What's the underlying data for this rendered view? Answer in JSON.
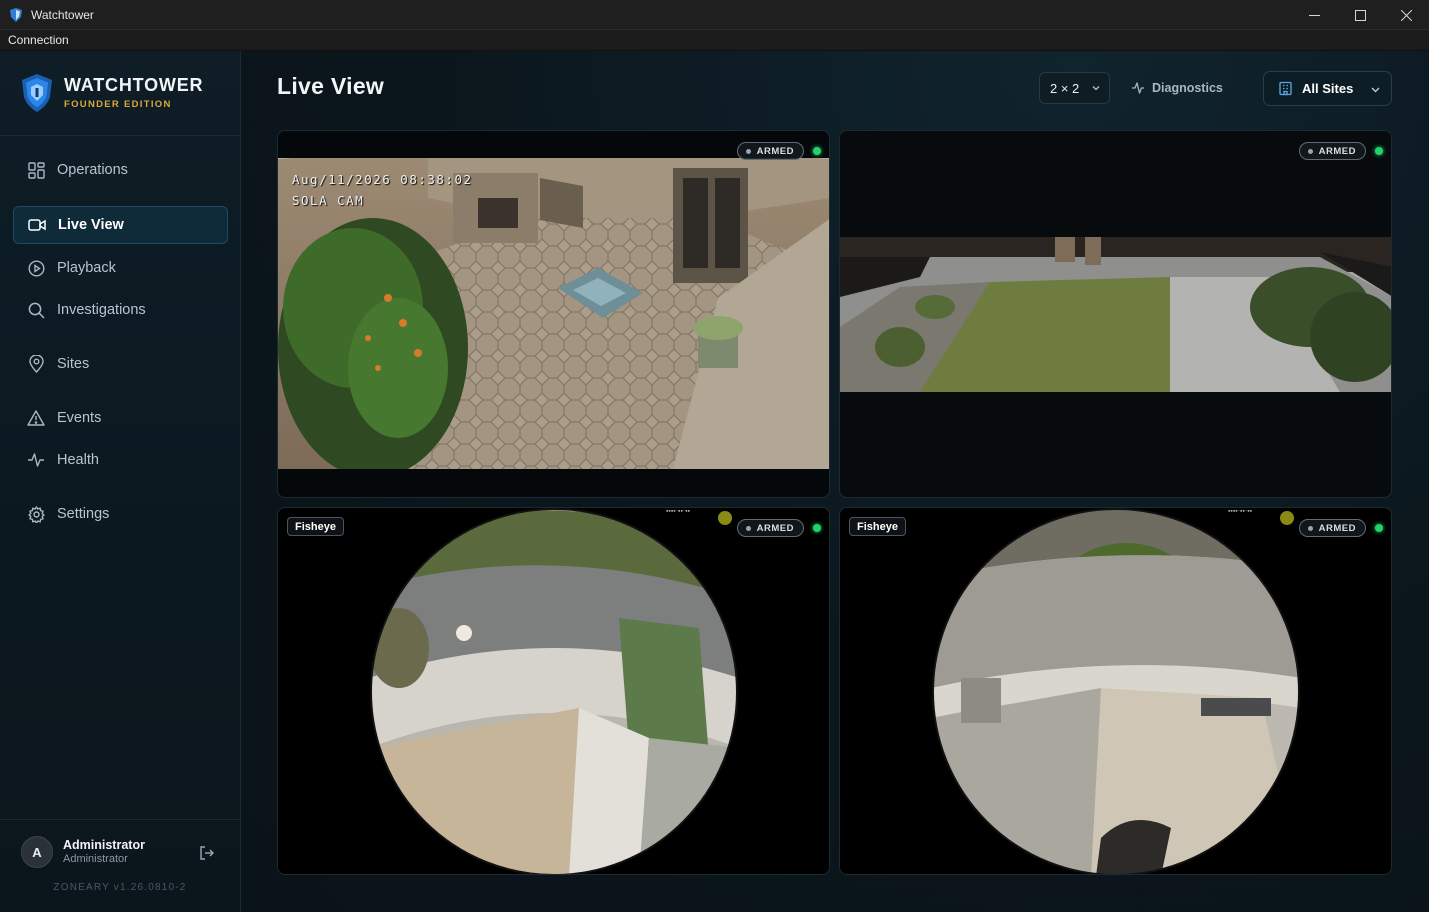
{
  "window": {
    "title": "Watchtower",
    "min": "—",
    "max": "☐",
    "close": "✕"
  },
  "menu": {
    "items": [
      "Connection"
    ]
  },
  "brand": {
    "name": "WATCHTOWER",
    "edition": "FOUNDER EDITION"
  },
  "nav": {
    "items": [
      {
        "label": "Operations",
        "icon": "grid-icon"
      },
      {
        "label": "Live View",
        "icon": "video-icon",
        "active": true
      },
      {
        "label": "Playback",
        "icon": "play-circle-icon"
      },
      {
        "label": "Investigations",
        "icon": "search-icon"
      },
      {
        "label": "Sites",
        "icon": "map-pin-icon"
      },
      {
        "label": "Events",
        "icon": "alert-triangle-icon"
      },
      {
        "label": "Health",
        "icon": "activity-icon"
      },
      {
        "label": "Settings",
        "icon": "gear-icon"
      }
    ]
  },
  "user": {
    "initial": "A",
    "name": "Administrator",
    "role": "Administrator",
    "version": "ZONEARY v1.26.0810-2"
  },
  "header": {
    "title": "Live View",
    "grid_layout": "2 × 2",
    "diagnostics": "Diagnostics",
    "sites": "All Sites"
  },
  "cameras": [
    {
      "status": "ARMED",
      "timestamp": "Aug/11/2026 08:38:02",
      "name": "SOLA CAM"
    },
    {
      "status": "ARMED"
    },
    {
      "status": "ARMED",
      "tag": "Fisheye"
    },
    {
      "status": "ARMED",
      "tag": "Fisheye"
    }
  ],
  "colors": {
    "accent": "#1f4a60",
    "live": "#22d36a",
    "brand_gold": "#d9a93a"
  }
}
